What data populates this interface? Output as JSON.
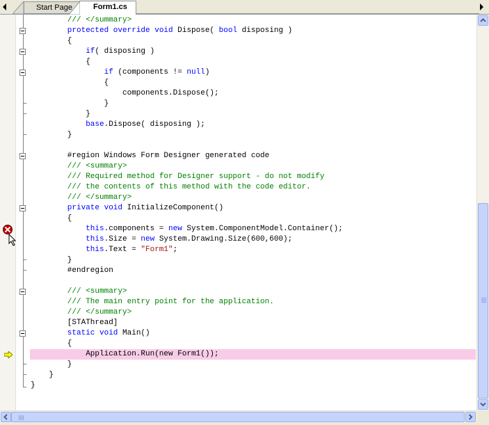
{
  "tabs": [
    {
      "label": "Start Page",
      "active": false
    },
    {
      "label": "Form1.cs",
      "active": true
    }
  ],
  "code_lines": [
    {
      "indent": 8,
      "parts": [
        {
          "t": "/// </summary>",
          "c": "cm"
        }
      ]
    },
    {
      "indent": 8,
      "parts": [
        {
          "t": "protected override void",
          "c": "kw"
        },
        {
          "t": " Dispose( ",
          "c": ""
        },
        {
          "t": "bool",
          "c": "kw"
        },
        {
          "t": " disposing )",
          "c": ""
        }
      ]
    },
    {
      "indent": 8,
      "parts": [
        {
          "t": "{",
          "c": ""
        }
      ]
    },
    {
      "indent": 12,
      "parts": [
        {
          "t": "if",
          "c": "kw"
        },
        {
          "t": "( disposing )",
          "c": ""
        }
      ]
    },
    {
      "indent": 12,
      "parts": [
        {
          "t": "{",
          "c": ""
        }
      ]
    },
    {
      "indent": 16,
      "parts": [
        {
          "t": "if",
          "c": "kw"
        },
        {
          "t": " (components != ",
          "c": ""
        },
        {
          "t": "null",
          "c": "kw"
        },
        {
          "t": ")",
          "c": ""
        }
      ]
    },
    {
      "indent": 16,
      "parts": [
        {
          "t": "{",
          "c": ""
        }
      ]
    },
    {
      "indent": 20,
      "parts": [
        {
          "t": "components.Dispose();",
          "c": ""
        }
      ]
    },
    {
      "indent": 16,
      "parts": [
        {
          "t": "}",
          "c": ""
        }
      ]
    },
    {
      "indent": 12,
      "parts": [
        {
          "t": "}",
          "c": ""
        }
      ]
    },
    {
      "indent": 12,
      "parts": [
        {
          "t": "base",
          "c": "kw"
        },
        {
          "t": ".Dispose( disposing );",
          "c": ""
        }
      ]
    },
    {
      "indent": 8,
      "parts": [
        {
          "t": "}",
          "c": ""
        }
      ]
    },
    {
      "indent": 0,
      "parts": []
    },
    {
      "indent": 8,
      "parts": [
        {
          "t": "#region Windows Form Designer generated code",
          "c": ""
        }
      ]
    },
    {
      "indent": 8,
      "parts": [
        {
          "t": "/// <summary>",
          "c": "cm"
        }
      ]
    },
    {
      "indent": 8,
      "parts": [
        {
          "t": "/// Required method for Designer support - do not modify",
          "c": "cm"
        }
      ]
    },
    {
      "indent": 8,
      "parts": [
        {
          "t": "/// the contents of this method with the code editor.",
          "c": "cm"
        }
      ]
    },
    {
      "indent": 8,
      "parts": [
        {
          "t": "/// </summary>",
          "c": "cm"
        }
      ]
    },
    {
      "indent": 8,
      "parts": [
        {
          "t": "private void",
          "c": "kw"
        },
        {
          "t": " InitializeComponent()",
          "c": ""
        }
      ]
    },
    {
      "indent": 8,
      "parts": [
        {
          "t": "{",
          "c": ""
        }
      ]
    },
    {
      "indent": 12,
      "parts": [
        {
          "t": "this",
          "c": "kw"
        },
        {
          "t": ".components = ",
          "c": ""
        },
        {
          "t": "new",
          "c": "kw"
        },
        {
          "t": " System.ComponentModel.Container();",
          "c": ""
        }
      ]
    },
    {
      "indent": 12,
      "parts": [
        {
          "t": "this",
          "c": "kw"
        },
        {
          "t": ".Size = ",
          "c": ""
        },
        {
          "t": "new",
          "c": "kw"
        },
        {
          "t": " System.Drawing.Size(600,600);",
          "c": ""
        }
      ]
    },
    {
      "indent": 12,
      "parts": [
        {
          "t": "this",
          "c": "kw"
        },
        {
          "t": ".Text = ",
          "c": ""
        },
        {
          "t": "\"Form1\"",
          "c": "st"
        },
        {
          "t": ";",
          "c": ""
        }
      ]
    },
    {
      "indent": 8,
      "parts": [
        {
          "t": "}",
          "c": ""
        }
      ]
    },
    {
      "indent": 8,
      "parts": [
        {
          "t": "#endregion",
          "c": ""
        }
      ]
    },
    {
      "indent": 0,
      "parts": []
    },
    {
      "indent": 8,
      "parts": [
        {
          "t": "/// <summary>",
          "c": "cm"
        }
      ]
    },
    {
      "indent": 8,
      "parts": [
        {
          "t": "/// The main entry point for the application.",
          "c": "cm"
        }
      ]
    },
    {
      "indent": 8,
      "parts": [
        {
          "t": "/// </summary>",
          "c": "cm"
        }
      ]
    },
    {
      "indent": 8,
      "parts": [
        {
          "t": "[STAThread]",
          "c": ""
        }
      ]
    },
    {
      "indent": 8,
      "parts": [
        {
          "t": "static void",
          "c": "kw"
        },
        {
          "t": " Main()",
          "c": ""
        }
      ]
    },
    {
      "indent": 8,
      "parts": [
        {
          "t": "{",
          "c": ""
        }
      ]
    },
    {
      "indent": 12,
      "parts": [
        {
          "t": "Application.Run(new Form1());",
          "c": ""
        }
      ]
    },
    {
      "indent": 8,
      "parts": [
        {
          "t": "}",
          "c": ""
        }
      ]
    },
    {
      "indent": 4,
      "parts": [
        {
          "t": "}",
          "c": ""
        }
      ]
    },
    {
      "indent": 0,
      "parts": [
        {
          "t": "}",
          "c": ""
        }
      ]
    }
  ],
  "breakpoint_line": 20,
  "current_execution_line": 32,
  "colors": {
    "keyword": "#0000ff",
    "comment": "#008000",
    "string": "#a31515",
    "execution_highlight": "#f8cce8",
    "breakpoint": "#c00000",
    "execution_arrow": "#ffff00"
  },
  "icons": {
    "breakpoint": "breakpoint-icon",
    "execution": "execution-pointer-icon",
    "cursor": "mouse-cursor-icon"
  }
}
